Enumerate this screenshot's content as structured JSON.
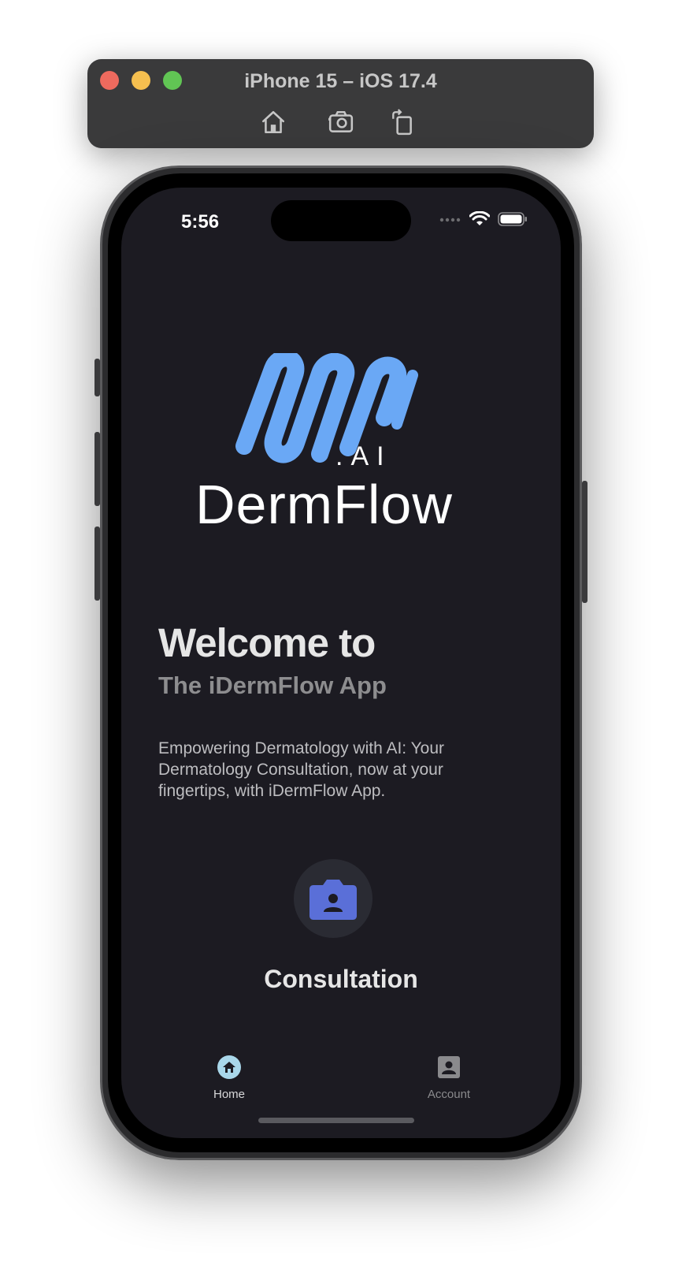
{
  "simulator": {
    "title": "iPhone 15 – iOS 17.4",
    "tools": [
      "home-icon",
      "screenshot-icon",
      "rotate-icon"
    ]
  },
  "status_bar": {
    "time": "5:56"
  },
  "logo": {
    "suffix": ".AI",
    "wordmark": "DermFlow",
    "colors": {
      "mark": "#6aa8f5",
      "text": "#ffffff"
    }
  },
  "hero": {
    "title": "Welcome to",
    "subtitle": "The iDermFlow App",
    "description": "Empowering Dermatology with AI: Your Dermatology Consultation, now at your fingertips, with iDermFlow App."
  },
  "consultation": {
    "label": "Consultation",
    "icon": "camera-account-icon",
    "icon_color": "#5a6fd8"
  },
  "tabs": [
    {
      "label": "Home",
      "icon": "home-icon",
      "active": true
    },
    {
      "label": "Account",
      "icon": "account-box-icon",
      "active": false
    }
  ],
  "colors": {
    "screen_bg": "#1c1b22",
    "active_tab_icon": "#a9d7ea",
    "inactive_tab_icon": "#8a8a8d"
  }
}
